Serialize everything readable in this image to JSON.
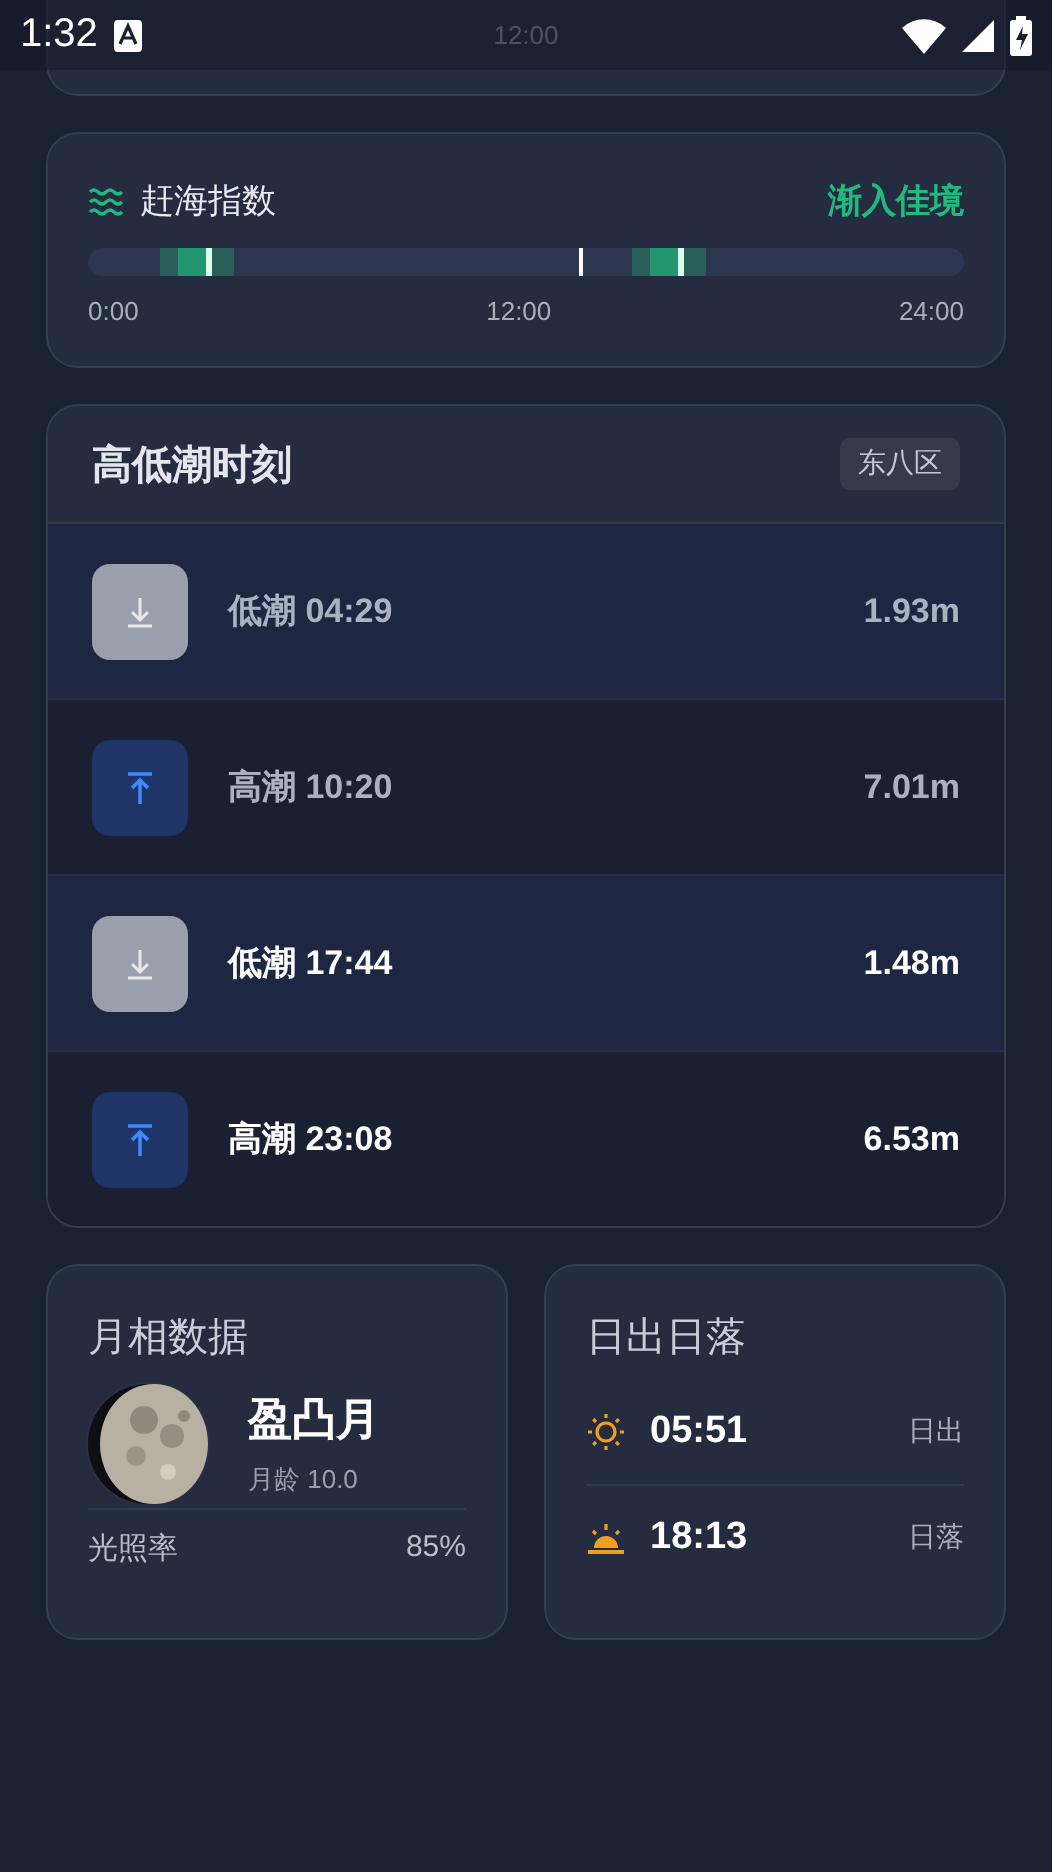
{
  "status_bar": {
    "time": "1:32"
  },
  "top_card": {
    "axis_label": "12:00"
  },
  "index_card": {
    "title": "赶海指数",
    "rating": "渐入佳境",
    "axis": [
      "0:00",
      "12:00",
      "24:00"
    ]
  },
  "tide_card": {
    "title": "高低潮时刻",
    "zone": "东八区",
    "rows": [
      {
        "kind": "low",
        "label": "低潮 04:29",
        "height": "1.93m",
        "past": true
      },
      {
        "kind": "high",
        "label": "高潮 10:20",
        "height": "7.01m",
        "past": true
      },
      {
        "kind": "low",
        "label": "低潮 17:44",
        "height": "1.48m",
        "past": false
      },
      {
        "kind": "high",
        "label": "高潮 23:08",
        "height": "6.53m",
        "past": false
      }
    ]
  },
  "moon_card": {
    "title": "月相数据",
    "phase": "盈凸月",
    "age": "月龄 10.0",
    "illum_label": "光照率",
    "illum_value": "85%"
  },
  "sun_card": {
    "title": "日出日落",
    "rows": [
      {
        "kind": "sunrise",
        "time": "05:51",
        "label": "日出"
      },
      {
        "kind": "sunset",
        "time": "18:13",
        "label": "日落"
      }
    ]
  }
}
